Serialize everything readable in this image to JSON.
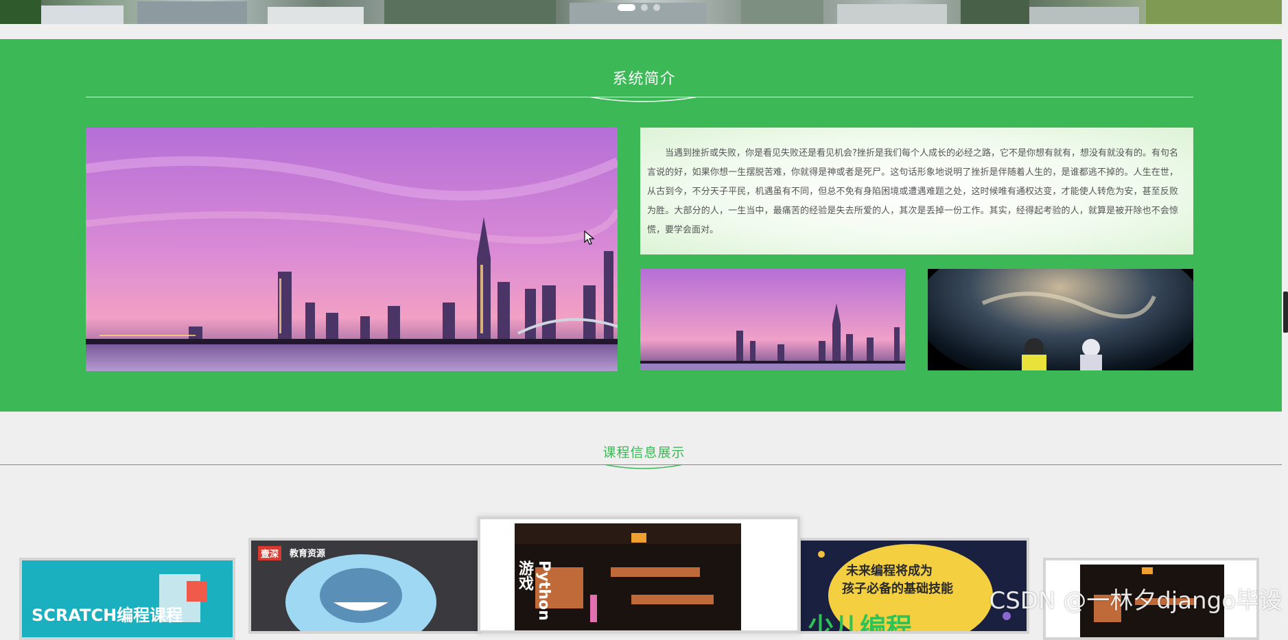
{
  "banner": {
    "slide_count": 3,
    "active_index": 0
  },
  "intro": {
    "title": "系统简介",
    "text": "当遇到挫折或失败，你是看见失败还是看见机会?挫折是我们每个人成长的必经之路，它不是你想有就有，想没有就没有的。有句名言说的好，如果你想一生摆脱苦难，你就得是神或者是死尸。这句话形象地说明了挫折是伴随着人生的，是谁都逃不掉的。人生在世，从古到今，不分天子平民，机遇虽有不同，但总不免有身陷困境或遭遇难题之处，这时候唯有通权达变，才能使人转危为安，甚至反败为胜。大部分的人，一生当中，最痛苦的经验是失去所爱的人，其次是丢掉一份工作。其实，经得起考验的人，就算是被开除也不会惊慌，要学会面对。",
    "colors": {
      "section_bg": "#3cb856",
      "text_box_bg": "#f2fbef"
    }
  },
  "courses": {
    "title": "课程信息展示",
    "cards": [
      {
        "label": "SCRATCH编程课程"
      },
      {
        "brand": "壹深",
        "brand_sub": "教育资源"
      },
      {
        "label": "Python游戏"
      },
      {
        "line1": "未来编程将成为",
        "line2": "孩子必备的基础技能",
        "big": "少儿编程"
      },
      {
        "label": ""
      }
    ]
  },
  "watermark": {
    "text": "CSDN @一林夕django毕设"
  }
}
